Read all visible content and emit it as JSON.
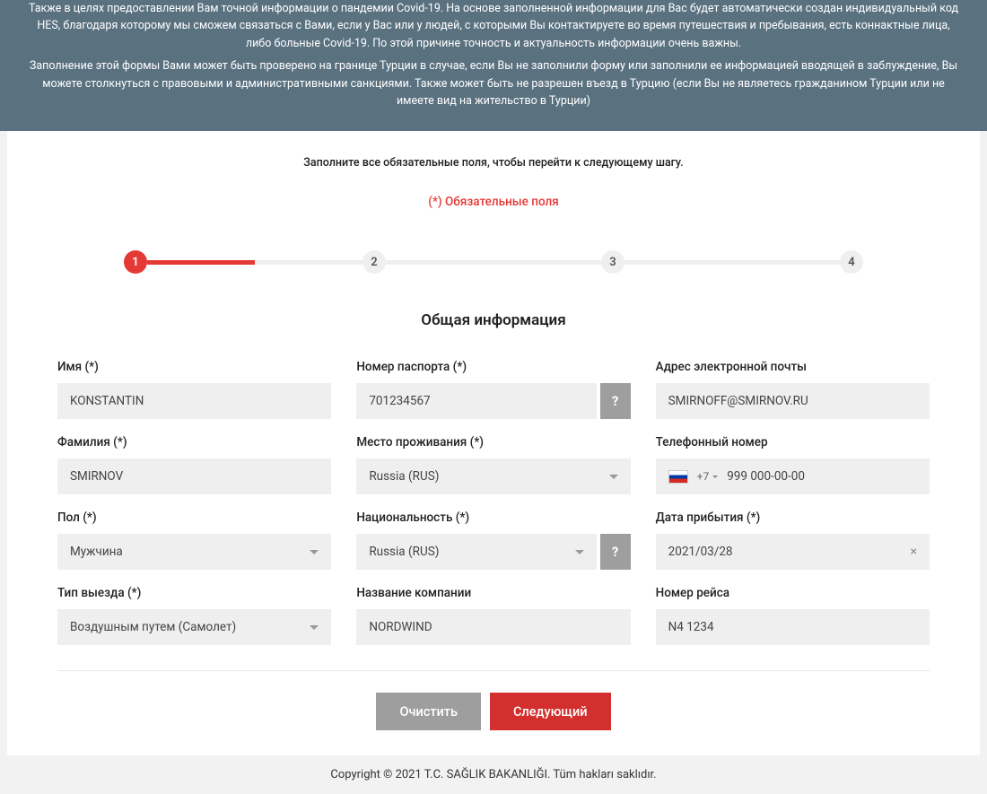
{
  "banner": {
    "p1": "Также в целях предоставлении Вам точной информации о пандемии Covid-19. На основе заполненной информации для Вас будет автоматически создан индивидуальный код HES, благодаря которому мы сможем связаться с Вами, если у Вас или у людей, с которыми Вы контактируете во время путешествия и пребывания, есть коннактные лица, либо больные Covid-19. По этой причине точность и актуальность информации очень важны.",
    "p2": "Заполнение этой формы Вами может быть проверено на границе Турции в случае, если Вы не заполнили форму или заполнили ее информацией вводящей в заблуждение, Вы можете столкнуться с правовыми и административными санкциями. Также может быть не разрешен въезд в Турцию (если Вы не являетесь гражданином Турции или не имеете вид на жительство в Турции)"
  },
  "instruction": "Заполните все обязательные поля, чтобы перейти к следующему шагу.",
  "required_note": "(*) Обязательные поля",
  "steps": [
    "1",
    "2",
    "3",
    "4"
  ],
  "section_title": "Общая информация",
  "labels": {
    "name": "Имя (*)",
    "surname": "Фамилия (*)",
    "sex": "Пол (*)",
    "exit_type": "Тип выезда (*)",
    "passport": "Номер паспорта (*)",
    "residence": "Место проживания (*)",
    "nationality": "Национальность (*)",
    "company": "Название компании",
    "email": "Адрес электронной почты",
    "phone": "Телефонный номер",
    "arrival": "Дата прибытия (*)",
    "flight": "Номер рейса"
  },
  "values": {
    "name": "KONSTANTIN",
    "surname": "SMIRNOV",
    "sex": "Мужчина",
    "exit_type": "Воздушным путем (Самолет)",
    "passport": "701234567",
    "residence": "Russia (RUS)",
    "nationality": "Russia (RUS)",
    "company": "NORDWIND",
    "email": "SMIRNOFF@SMIRNOV.RU",
    "phone_code": "+7",
    "phone_num": "999 000-00-00",
    "arrival": "2021/03/28",
    "flight": "N4 1234"
  },
  "help_symbol": "?",
  "clear_symbol": "×",
  "buttons": {
    "clear": "Очистить",
    "next": "Следующий"
  },
  "footer": "Copyright © 2021 T.C. SAĞLIK BAKANLIĞI. Tüm hakları saklıdır."
}
